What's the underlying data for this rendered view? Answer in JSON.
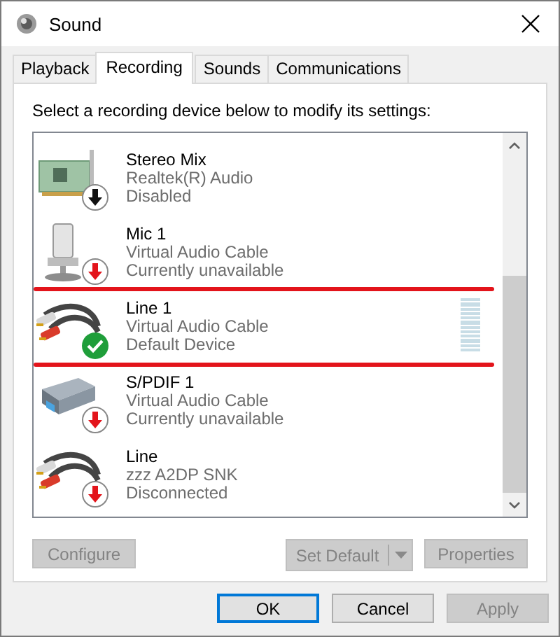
{
  "window": {
    "title": "Sound"
  },
  "tabs": [
    {
      "label": "Playback",
      "selected": false
    },
    {
      "label": "Recording",
      "selected": true
    },
    {
      "label": "Sounds",
      "selected": false
    },
    {
      "label": "Communications",
      "selected": false
    }
  ],
  "instruction": "Select a recording device below to modify its settings:",
  "devices": [
    {
      "kind": "card",
      "name": "Stereo Mix",
      "driver": "Realtek(R) Audio",
      "status": "Disabled",
      "badge": {
        "kind": "disabled"
      },
      "highlighted": false
    },
    {
      "kind": "mic",
      "name": "Mic 1",
      "driver": "Virtual Audio Cable",
      "status": "Currently unavailable",
      "badge": {
        "kind": "unavailable"
      },
      "highlighted": false
    },
    {
      "kind": "cable",
      "name": "Line 1",
      "driver": "Virtual Audio Cable",
      "status": "Default Device",
      "badge": {
        "kind": "default"
      },
      "highlighted": true,
      "meter": true
    },
    {
      "kind": "spdif",
      "name": "S/PDIF 1",
      "driver": "Virtual Audio Cable",
      "status": "Currently unavailable",
      "badge": {
        "kind": "unavailable"
      },
      "highlighted": false
    },
    {
      "kind": "cable",
      "name": "Line",
      "driver": "zzz A2DP SNK",
      "status": "Disconnected",
      "badge": {
        "kind": "unavailable"
      },
      "highlighted": false
    }
  ],
  "panel_buttons": [
    {
      "label": "Configure",
      "disabled": true,
      "split": false
    },
    {
      "label": "Set Default",
      "disabled": true,
      "split": true
    },
    {
      "label": "Properties",
      "disabled": true,
      "split": false
    }
  ],
  "dialog_buttons": [
    {
      "label": "OK",
      "disabled": false,
      "default": true
    },
    {
      "label": "Cancel",
      "disabled": false,
      "default": false
    },
    {
      "label": "Apply",
      "disabled": true,
      "default": false
    }
  ]
}
